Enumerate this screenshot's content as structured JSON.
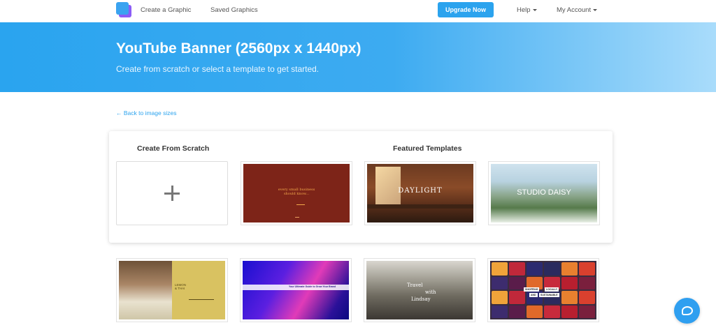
{
  "nav": {
    "create": "Create a Graphic",
    "saved": "Saved Graphics",
    "upgrade": "Upgrade Now",
    "help": "Help",
    "account": "My Account"
  },
  "hero": {
    "title": "YouTube Banner (2560px x 1440px)",
    "subtitle": "Create from scratch or select a template to get started."
  },
  "back_link": "← Back to image sizes",
  "panel": {
    "scratch_heading": "Create From Scratch",
    "featured_heading": "Featured Templates"
  },
  "templates": {
    "red": {
      "line1": "every small business",
      "line2": "should know..."
    },
    "daylight": {
      "label": "DAYLIGHT"
    },
    "daisy": {
      "label": "STUDIO DAISY"
    },
    "lemon": {
      "line1": "LEMON",
      "line2": "& THAI"
    },
    "neon": {
      "label": "Your Ultimate Guide to Grow Your Brand"
    },
    "travel": {
      "line1": "Travel",
      "line2": "with",
      "line3": "Lindsay"
    },
    "berries": {
      "tag1": "SHOPPING",
      "tag2": "LOCALLY",
      "tag3": "AND",
      "tag4": "SUSTAINABLE"
    }
  },
  "colors": {
    "accent": "#2ba3ee",
    "hero_start": "#2aa4ef",
    "hero_end": "#a9dcfb"
  }
}
